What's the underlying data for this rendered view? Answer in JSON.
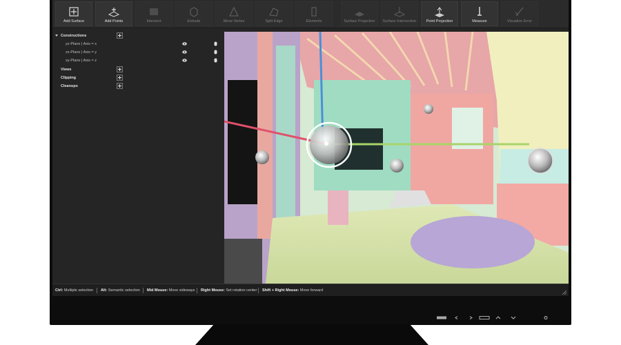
{
  "toolbar": {
    "tools": [
      {
        "label": "Add Surface",
        "icon": "add-surface-icon",
        "enabled": true
      },
      {
        "label": "Add Points",
        "icon": "add-points-icon",
        "enabled": true
      },
      {
        "label": "Intersect",
        "icon": "intersect-icon",
        "enabled": false
      },
      {
        "label": "Extrude",
        "icon": "extrude-icon",
        "enabled": false
      },
      {
        "label": "Move Vertex",
        "icon": "move-vertex-icon",
        "enabled": false
      },
      {
        "label": "Split Edge",
        "icon": "split-edge-icon",
        "enabled": false
      },
      {
        "label": "Elements",
        "icon": "elements-icon",
        "enabled": false
      },
      {
        "label": "Surface Projection",
        "icon": "surface-projection-icon",
        "enabled": false
      },
      {
        "label": "Surface Intersection",
        "icon": "surface-intersection-icon",
        "enabled": false
      },
      {
        "label": "Point Projection",
        "icon": "point-projection-icon",
        "enabled": true
      },
      {
        "label": "Measure",
        "icon": "measure-icon",
        "enabled": true
      },
      {
        "label": "Visualize Error",
        "icon": "visualize-error-icon",
        "enabled": false
      }
    ]
  },
  "sidebar": {
    "constructions": {
      "label": "Constructions",
      "items": [
        {
          "label": "yz-Plane | Axis = x"
        },
        {
          "label": "zx-Plane | Axis = y"
        },
        {
          "label": "xy-Plane | Axis = z"
        }
      ]
    },
    "views": {
      "label": "Views"
    },
    "clipping": {
      "label": "Clipping"
    },
    "cleanups": {
      "label": "Cleanups"
    }
  },
  "statusbar": {
    "items": [
      {
        "key": "Ctrl:",
        "value": "Multiple selection"
      },
      {
        "key": "Alt:",
        "value": "Semantic selection"
      },
      {
        "key": "Mid Mouse:",
        "value": "Move sideways"
      },
      {
        "key": "Right Mouse:",
        "value": "Set rotation center"
      },
      {
        "key": "Shift + Right Mouse:",
        "value": "Move forward"
      }
    ]
  },
  "colors": {
    "x_axis": "#e0506a",
    "y_axis": "#a8d46a",
    "z_axis": "#4a8fd8",
    "panel_bg": "#252525"
  }
}
